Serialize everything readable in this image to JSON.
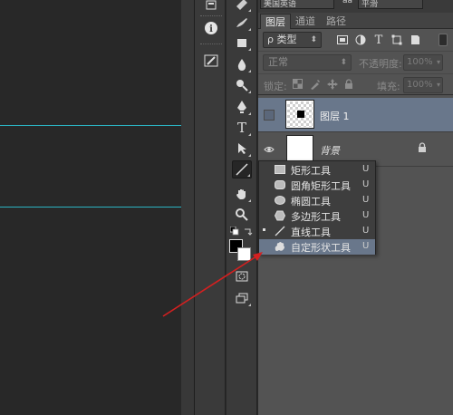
{
  "options_bar": {
    "font_family_value": "美国英语",
    "font_smoothing_label": "aa",
    "font_smoothing_value": "平滑"
  },
  "panel": {
    "tabs": [
      {
        "label": "图层"
      },
      {
        "label": "通道"
      },
      {
        "label": "路径"
      }
    ],
    "filter": {
      "kind_label": "ρ 类型",
      "icons": [
        "image-filter-icon",
        "adjustment-filter-icon",
        "type-filter-icon",
        "shape-filter-icon",
        "smart-object-filter-icon"
      ]
    },
    "blend": {
      "mode_value": "正常",
      "opacity_label": "不透明度:",
      "opacity_value": "100%"
    },
    "lock": {
      "label": "锁定:",
      "fill_label": "填充:",
      "fill_value": "100%"
    },
    "layers": [
      {
        "name": "图层 1",
        "visible": false,
        "selected": true
      },
      {
        "name": "背景",
        "visible": true,
        "selected": false,
        "locked": true
      }
    ]
  },
  "shape_flyout": {
    "items": [
      {
        "label": "矩形工具",
        "shortcut": "U",
        "icon": "rectangle-tool-icon",
        "active": false
      },
      {
        "label": "圆角矩形工具",
        "shortcut": "U",
        "icon": "rounded-rectangle-tool-icon",
        "active": false
      },
      {
        "label": "椭圆工具",
        "shortcut": "U",
        "icon": "ellipse-tool-icon",
        "active": false
      },
      {
        "label": "多边形工具",
        "shortcut": "U",
        "icon": "polygon-tool-icon",
        "active": false
      },
      {
        "label": "直线工具",
        "shortcut": "U",
        "icon": "line-tool-icon",
        "active": true
      },
      {
        "label": "自定形状工具",
        "shortcut": "U",
        "icon": "custom-shape-tool-icon",
        "active": false,
        "hovered": true
      }
    ]
  },
  "toolbar": {
    "tools": [
      "healing-brush-icon",
      "brush-icon",
      "clone-stamp-icon",
      "history-brush-icon",
      "eraser-icon",
      "gradient-icon",
      "blur-icon",
      "dodge-icon",
      "pen-icon",
      "type-icon",
      "path-selection-icon",
      "line-tool-icon",
      "hand-icon",
      "zoom-icon"
    ],
    "quick_mask_icon": "quick-mask-icon",
    "screen_mode_icon": "screen-mode-icon",
    "type_tool_glyph": "T"
  },
  "mini_panel": {
    "icons": [
      "history-icon",
      "info-icon",
      "brush-settings-icon"
    ],
    "info_glyph": "i"
  },
  "colors": {
    "foreground": "#000000",
    "background": "#ffffff",
    "selection_highlight": "#69778b",
    "guide_line": "#2bb3c2",
    "annotation_arrow": "#d42020"
  }
}
